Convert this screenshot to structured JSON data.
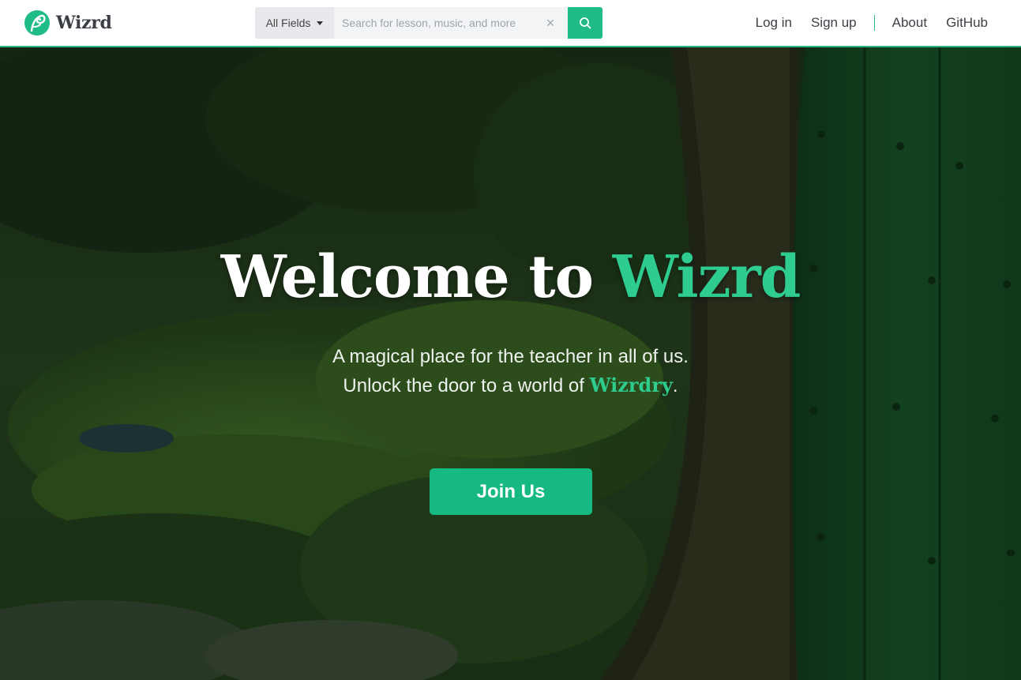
{
  "brand": {
    "name": "Wizrd",
    "logo_icon": "feather-leaf-logo",
    "accent_color": "#1fbb88"
  },
  "search": {
    "field_select": "All Fields",
    "placeholder": "Search for lesson, music, and more",
    "clear_icon": "×",
    "search_icon": "search-icon"
  },
  "nav": {
    "login": "Log in",
    "signup": "Sign up",
    "about": "About",
    "github": "GitHub"
  },
  "hero": {
    "title_prefix": "Welcome to ",
    "title_accent": "Wizrd",
    "subtitle_line1": "A magical place for the teacher in all of us.",
    "subtitle_line2_prefix": "Unlock the door to a world of ",
    "subtitle_line2_accent": "Wizrdry",
    "subtitle_line2_suffix": ".",
    "cta_label": "Join Us"
  }
}
